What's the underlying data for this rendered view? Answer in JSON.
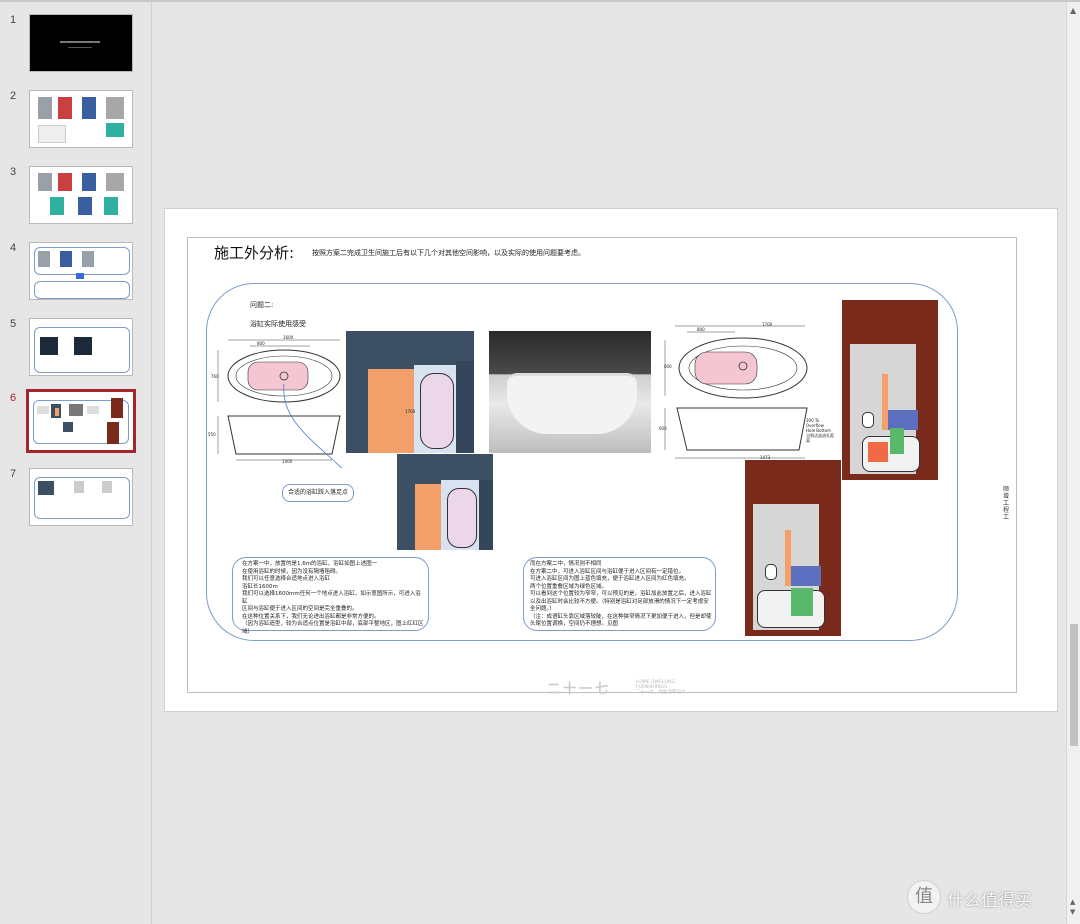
{
  "thumbnails": [
    {
      "num": "1",
      "active": false
    },
    {
      "num": "2",
      "active": false
    },
    {
      "num": "3",
      "active": false
    },
    {
      "num": "4",
      "active": false
    },
    {
      "num": "5",
      "active": false
    },
    {
      "num": "6",
      "active": true
    },
    {
      "num": "7",
      "active": false
    }
  ],
  "slide": {
    "title": "施工外分析:",
    "subtitle": "按照方案二完成卫生间施工后有以下几个对其他空间影响，以及实际的使用问题要考虑。",
    "question_label": "问题二:",
    "question_title": "浴缸实际使用感受",
    "pill_label": "合适的浴缸踩入落足点",
    "left_note": "在方案一中，放置的是1.6m的浴缸，浴缸如图上述图一\n在使用浴缸的时候，因为没有隔墙阻碍。\n我们可以任意选择合适地点进入浴缸\n浴缸长1600m\n我们可以选择1600mm任何一个地点进入浴缸，如示意图所示，可进入浴缸\n区间与浴缸便于进入区间的空间是完全重叠的。\n在这种位置关系下，我们无论进出浴缸都是非常方便的。\n（因为浴缸造型，较为合适点位置是浴缸中部，底部平整地区，图上红红区\n域）",
    "right_note": "而在方案二中，情况则不相同\n在方案二中，可进入浴缸区间与浴缸便于进入区间有一定错位。\n可进入浴缸区间为图上蓝色填充，便于浴缸进入区间为红色填充。\n两个位置重叠区域为绿色区域。\n可以看到这个位置较为窄窄，可以预见的是，浴缸加此放置之后，进入浴缸\n以及出浴缸时会比较不方便。（特别是浴缸对足部放滑的情况下一定考虑安\n全问题。）\n（注：成语缸头靠区域落较陡，在这种狭窄情况下更加便于进入，但是却使\n头尾位置调换，空间仍不理想。见图",
    "dims_left": {
      "top": "1600",
      "inner": "800",
      "side": "760",
      "side2": "550",
      "bottom": "1400",
      "plan": "1700"
    },
    "dims_right": {
      "top": "1700",
      "inner": "800",
      "side": "600",
      "side2": "600",
      "bottom": "1473",
      "overflow": "300 To Overflow Hole Bottom 当到达溢流孔距离"
    },
    "vertical_text": "顺增工程工",
    "footer_logo": "二十一七",
    "footer_sub": "HOME DWELLING\nFURNISHINGS\n二十一七，为生活而设计"
  },
  "watermark": {
    "icon": "值",
    "text": "什么值得买"
  },
  "colors": {
    "accent_active": "#a4262c",
    "callout_border": "#7b9bd1",
    "wall": "#3c4f63",
    "orange": "#f4a06a",
    "brown": "#7a2a1a"
  }
}
